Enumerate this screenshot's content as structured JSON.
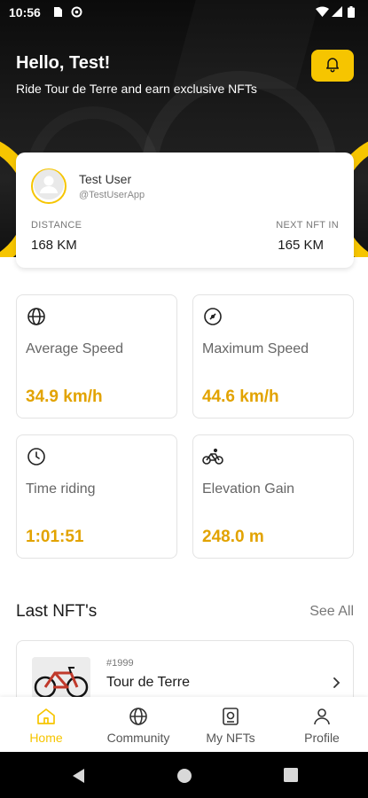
{
  "status_bar": {
    "time": "10:56"
  },
  "header": {
    "greeting": "Hello, Test!",
    "subtitle": "Ride Tour de Terre and earn exclusive NFTs"
  },
  "profile": {
    "name": "Test User",
    "handle": "@TestUserApp",
    "distance_label": "DISTANCE",
    "distance_value": "168 KM",
    "next_nft_label": "NEXT NFT IN",
    "next_nft_value": "165 KM"
  },
  "metrics": [
    {
      "icon": "globe-icon",
      "label": "Average Speed",
      "value": "34.9 km/h"
    },
    {
      "icon": "speedometer-icon",
      "label": "Maximum Speed",
      "value": "44.6 km/h"
    },
    {
      "icon": "clock-icon",
      "label": "Time riding",
      "value": "1:01:51"
    },
    {
      "icon": "bicycle-icon",
      "label": "Elevation Gain",
      "value": "248.0 m"
    }
  ],
  "last_nfts": {
    "title": "Last NFT's",
    "see_all": "See All",
    "items": [
      {
        "number": "#1999",
        "name": "Tour de Terre"
      }
    ]
  },
  "bottom_nav": [
    {
      "label": "Home",
      "icon": "home-icon",
      "active": true
    },
    {
      "label": "Community",
      "icon": "globe-icon",
      "active": false
    },
    {
      "label": "My NFTs",
      "icon": "nft-icon",
      "active": false
    },
    {
      "label": "Profile",
      "icon": "person-icon",
      "active": false
    }
  ],
  "colors": {
    "accent": "#f6c500",
    "value": "#e2a300",
    "dark": "#111111"
  }
}
